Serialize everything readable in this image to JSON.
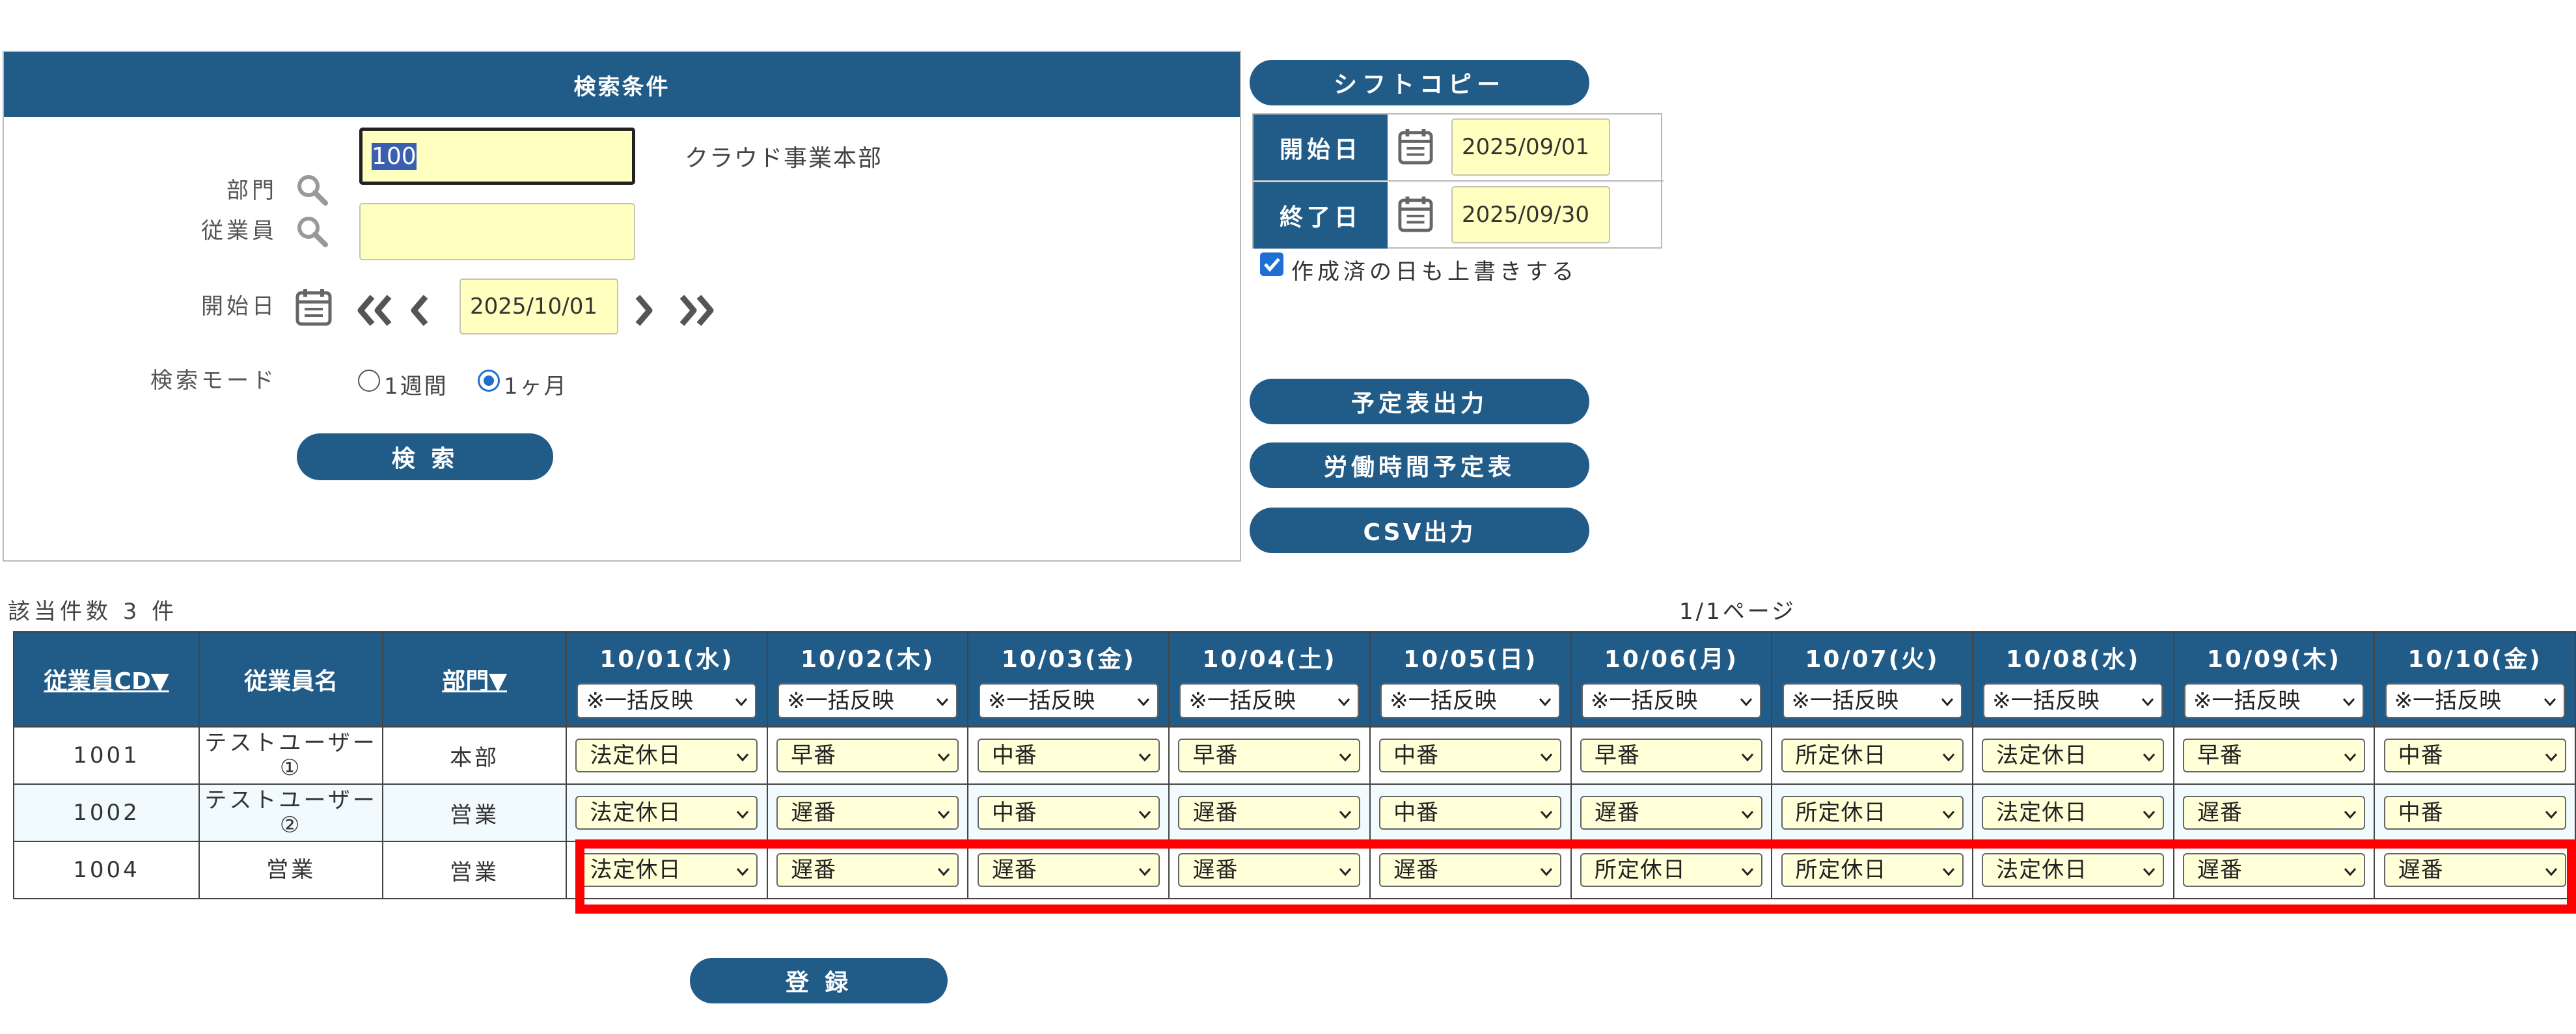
{
  "search": {
    "header": "検索条件",
    "dept_label": "部門",
    "dept_value": "100",
    "dept_name": "クラウド事業本部",
    "employee_label": "従業員",
    "employee_value": "",
    "start_label": "開始日",
    "start_value": "2025/10/01",
    "mode_label": "検索モード",
    "mode_week": "1週間",
    "mode_month": "1ヶ月",
    "mode_selected": "1ヶ月",
    "search_button": "検 索"
  },
  "shift_copy": {
    "button": "シフトコピー",
    "start_label": "開始日",
    "start_value": "2025/09/01",
    "end_label": "終了日",
    "end_value": "2025/09/30",
    "overwrite_label": "作成済の日も上書きする",
    "overwrite_checked": true
  },
  "actions": {
    "schedule_output": "予定表出力",
    "labor_hours": "労働時間予定表",
    "csv_output": "CSV出力",
    "register": "登 録"
  },
  "results": {
    "count_text": "該当件数 3 件",
    "page_text": "1/1ページ",
    "col_emp_cd": "従業員CD▼",
    "col_emp_name": "従業員名",
    "col_dept": "部門▼",
    "dates": [
      "10/01(水)",
      "10/02(木)",
      "10/03(金)",
      "10/04(土)",
      "10/05(日)",
      "10/06(月)",
      "10/07(火)",
      "10/08(水)",
      "10/09(木)",
      "10/10(金)"
    ],
    "bulk_option": "※一括反映",
    "rows": [
      {
        "cd": "1001",
        "name_line1": "テストユーザー",
        "name_line2": "①",
        "dept": "本部",
        "shifts": [
          "法定休日",
          "早番",
          "中番",
          "早番",
          "中番",
          "早番",
          "所定休日",
          "法定休日",
          "早番",
          "中番"
        ]
      },
      {
        "cd": "1002",
        "name_line1": "テストユーザー",
        "name_line2": "②",
        "dept": "営業",
        "shifts": [
          "法定休日",
          "遅番",
          "中番",
          "遅番",
          "中番",
          "遅番",
          "所定休日",
          "法定休日",
          "遅番",
          "中番"
        ]
      },
      {
        "cd": "1004",
        "name_line1": "営業",
        "name_line2": "",
        "dept": "営業",
        "shifts": [
          "法定休日",
          "遅番",
          "遅番",
          "遅番",
          "遅番",
          "所定休日",
          "所定休日",
          "法定休日",
          "遅番",
          "遅番"
        ]
      }
    ]
  },
  "colors": {
    "header_bg": "#215b88",
    "input_bg": "#ffffc0",
    "highlight": "#ff0000"
  }
}
